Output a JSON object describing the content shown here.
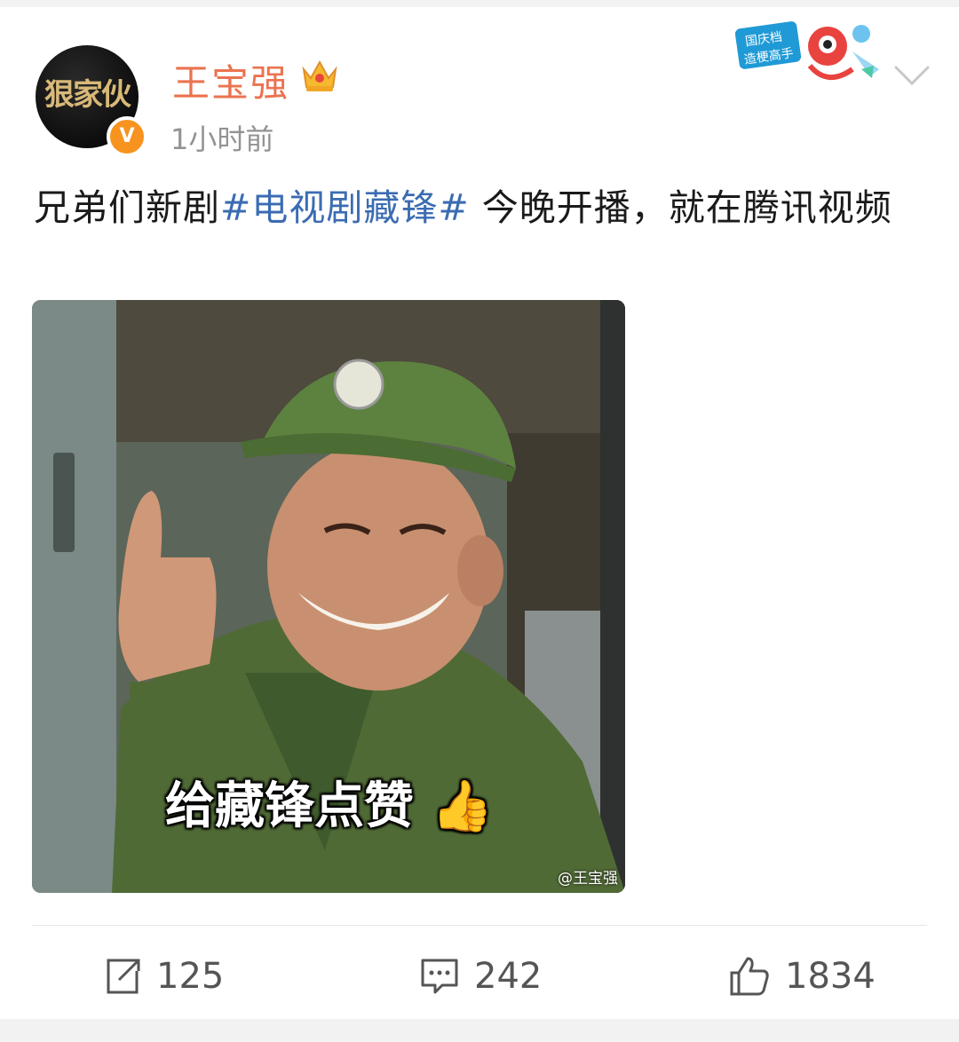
{
  "post": {
    "author": "王宝强",
    "timestamp": "1小时前",
    "avatar_text": "狠家伙",
    "badge_text": "国庆档 造梗高手",
    "text_before": "兄弟们新剧",
    "hashtag": "#电视剧藏锋#",
    "text_after": " 今晚开播，就在腾讯视频",
    "image_caption": "给藏锋点赞",
    "watermark": "@王宝强"
  },
  "actions": {
    "repost_count": "125",
    "comment_count": "242",
    "like_count": "1834"
  },
  "colors": {
    "author": "#eb7350",
    "hashtag": "#3b6cb2",
    "verified": "#f7931e"
  }
}
